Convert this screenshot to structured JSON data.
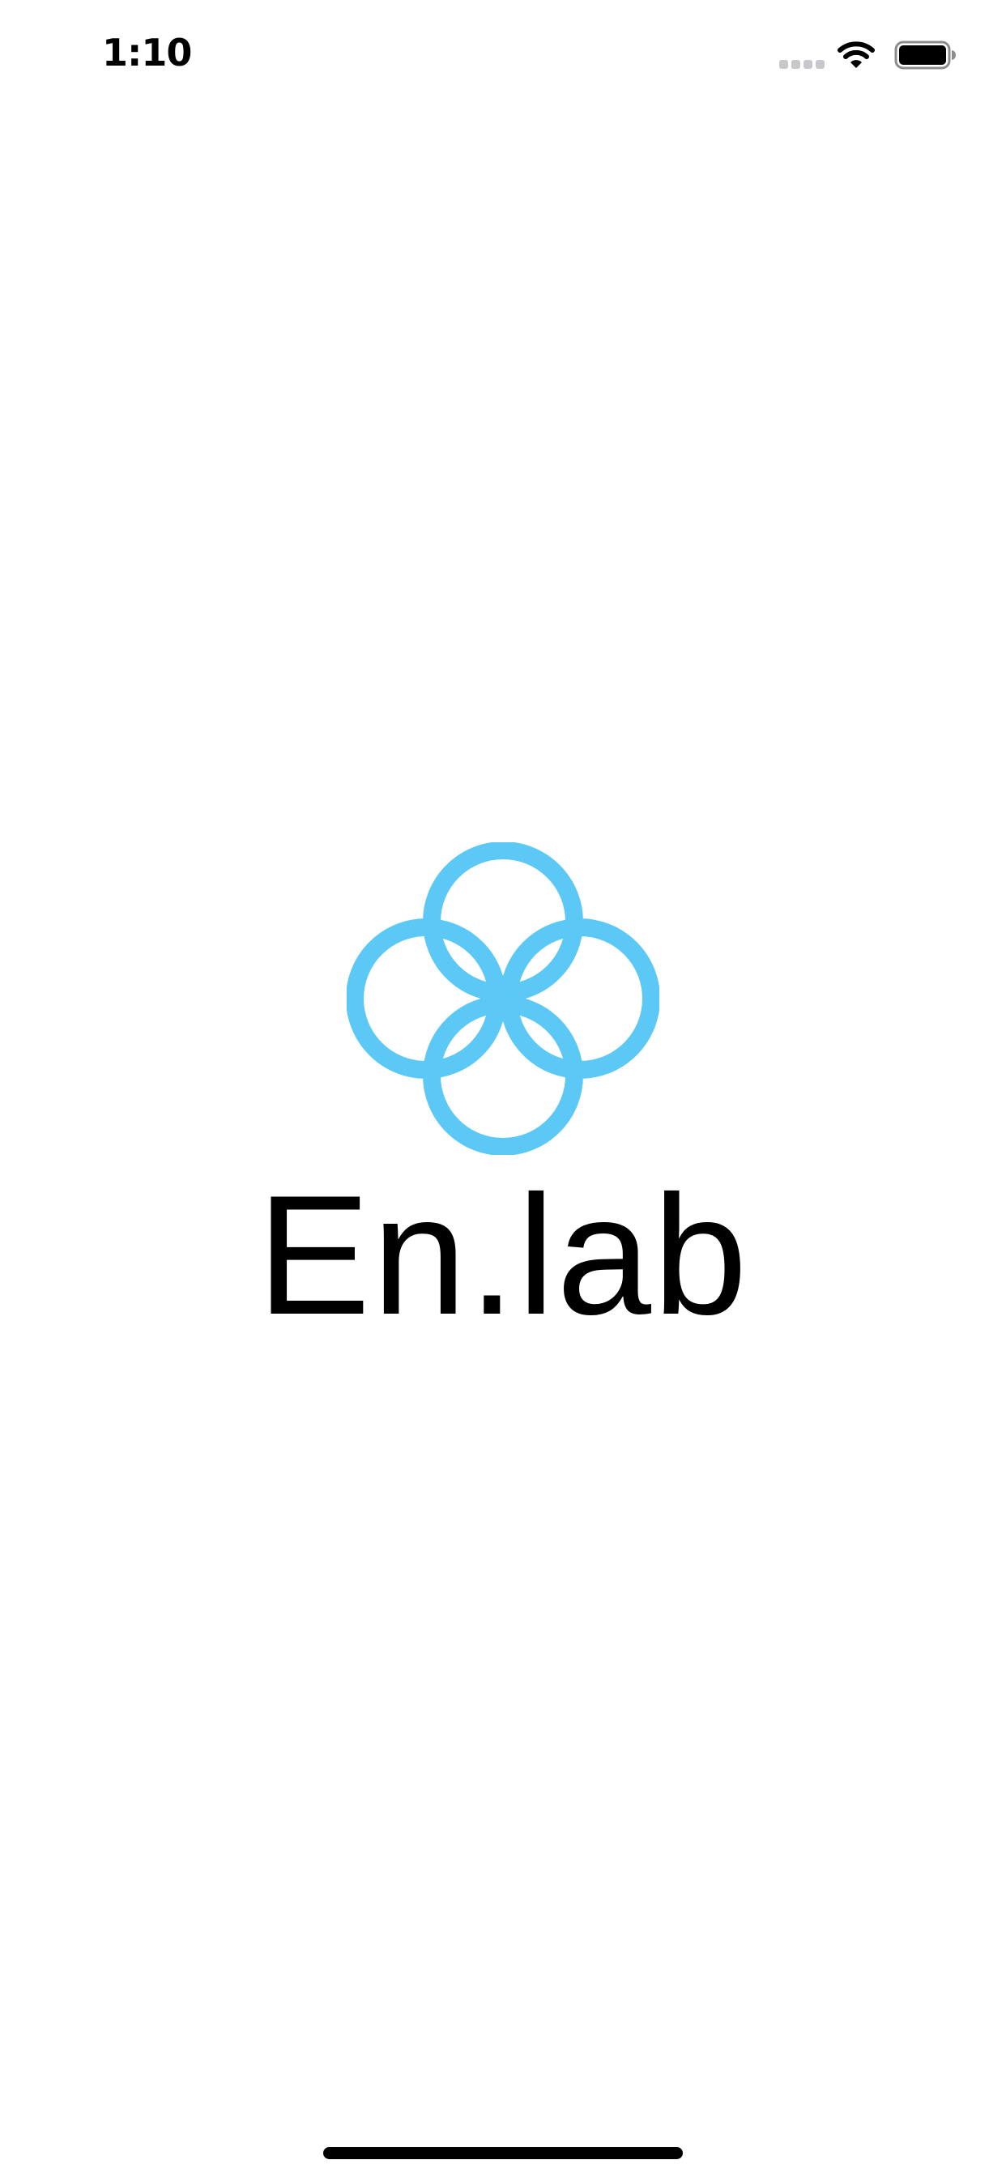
{
  "status_bar": {
    "time": "1:10",
    "signal_icon": "cellular-signal-icon",
    "wifi_icon": "wifi-icon",
    "battery_icon": "battery-icon"
  },
  "splash": {
    "logo_icon": "four-circle-flower-logo",
    "logo_color": "#5BC8F5",
    "logo_text": "En.lab",
    "text_color": "#000000"
  },
  "home_indicator": {
    "color": "#000000"
  }
}
